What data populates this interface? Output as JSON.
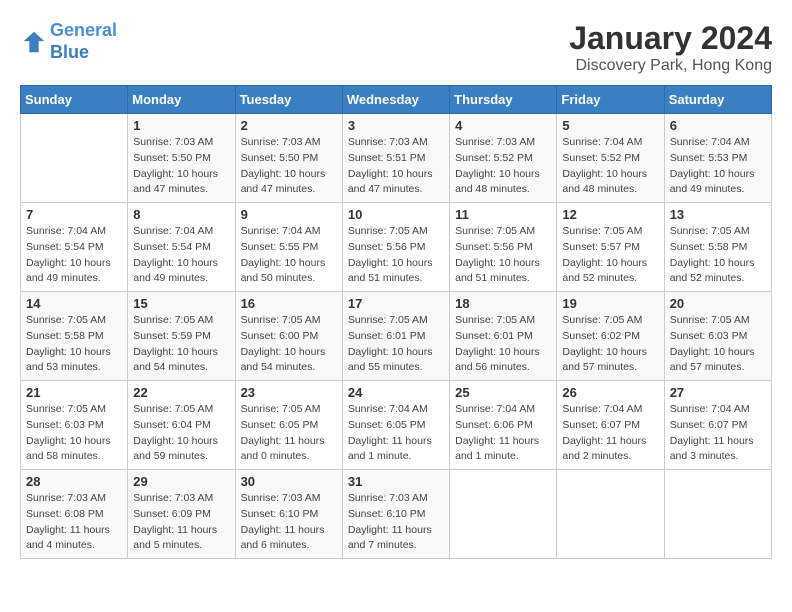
{
  "header": {
    "logo_line1": "General",
    "logo_line2": "Blue",
    "title": "January 2024",
    "subtitle": "Discovery Park, Hong Kong"
  },
  "days_of_week": [
    "Sunday",
    "Monday",
    "Tuesday",
    "Wednesday",
    "Thursday",
    "Friday",
    "Saturday"
  ],
  "weeks": [
    [
      {
        "day": "",
        "sunrise": "",
        "sunset": "",
        "daylight": ""
      },
      {
        "day": "1",
        "sunrise": "Sunrise: 7:03 AM",
        "sunset": "Sunset: 5:50 PM",
        "daylight": "Daylight: 10 hours and 47 minutes."
      },
      {
        "day": "2",
        "sunrise": "Sunrise: 7:03 AM",
        "sunset": "Sunset: 5:50 PM",
        "daylight": "Daylight: 10 hours and 47 minutes."
      },
      {
        "day": "3",
        "sunrise": "Sunrise: 7:03 AM",
        "sunset": "Sunset: 5:51 PM",
        "daylight": "Daylight: 10 hours and 47 minutes."
      },
      {
        "day": "4",
        "sunrise": "Sunrise: 7:03 AM",
        "sunset": "Sunset: 5:52 PM",
        "daylight": "Daylight: 10 hours and 48 minutes."
      },
      {
        "day": "5",
        "sunrise": "Sunrise: 7:04 AM",
        "sunset": "Sunset: 5:52 PM",
        "daylight": "Daylight: 10 hours and 48 minutes."
      },
      {
        "day": "6",
        "sunrise": "Sunrise: 7:04 AM",
        "sunset": "Sunset: 5:53 PM",
        "daylight": "Daylight: 10 hours and 49 minutes."
      }
    ],
    [
      {
        "day": "7",
        "sunrise": "Sunrise: 7:04 AM",
        "sunset": "Sunset: 5:54 PM",
        "daylight": "Daylight: 10 hours and 49 minutes."
      },
      {
        "day": "8",
        "sunrise": "Sunrise: 7:04 AM",
        "sunset": "Sunset: 5:54 PM",
        "daylight": "Daylight: 10 hours and 49 minutes."
      },
      {
        "day": "9",
        "sunrise": "Sunrise: 7:04 AM",
        "sunset": "Sunset: 5:55 PM",
        "daylight": "Daylight: 10 hours and 50 minutes."
      },
      {
        "day": "10",
        "sunrise": "Sunrise: 7:05 AM",
        "sunset": "Sunset: 5:56 PM",
        "daylight": "Daylight: 10 hours and 51 minutes."
      },
      {
        "day": "11",
        "sunrise": "Sunrise: 7:05 AM",
        "sunset": "Sunset: 5:56 PM",
        "daylight": "Daylight: 10 hours and 51 minutes."
      },
      {
        "day": "12",
        "sunrise": "Sunrise: 7:05 AM",
        "sunset": "Sunset: 5:57 PM",
        "daylight": "Daylight: 10 hours and 52 minutes."
      },
      {
        "day": "13",
        "sunrise": "Sunrise: 7:05 AM",
        "sunset": "Sunset: 5:58 PM",
        "daylight": "Daylight: 10 hours and 52 minutes."
      }
    ],
    [
      {
        "day": "14",
        "sunrise": "Sunrise: 7:05 AM",
        "sunset": "Sunset: 5:58 PM",
        "daylight": "Daylight: 10 hours and 53 minutes."
      },
      {
        "day": "15",
        "sunrise": "Sunrise: 7:05 AM",
        "sunset": "Sunset: 5:59 PM",
        "daylight": "Daylight: 10 hours and 54 minutes."
      },
      {
        "day": "16",
        "sunrise": "Sunrise: 7:05 AM",
        "sunset": "Sunset: 6:00 PM",
        "daylight": "Daylight: 10 hours and 54 minutes."
      },
      {
        "day": "17",
        "sunrise": "Sunrise: 7:05 AM",
        "sunset": "Sunset: 6:01 PM",
        "daylight": "Daylight: 10 hours and 55 minutes."
      },
      {
        "day": "18",
        "sunrise": "Sunrise: 7:05 AM",
        "sunset": "Sunset: 6:01 PM",
        "daylight": "Daylight: 10 hours and 56 minutes."
      },
      {
        "day": "19",
        "sunrise": "Sunrise: 7:05 AM",
        "sunset": "Sunset: 6:02 PM",
        "daylight": "Daylight: 10 hours and 57 minutes."
      },
      {
        "day": "20",
        "sunrise": "Sunrise: 7:05 AM",
        "sunset": "Sunset: 6:03 PM",
        "daylight": "Daylight: 10 hours and 57 minutes."
      }
    ],
    [
      {
        "day": "21",
        "sunrise": "Sunrise: 7:05 AM",
        "sunset": "Sunset: 6:03 PM",
        "daylight": "Daylight: 10 hours and 58 minutes."
      },
      {
        "day": "22",
        "sunrise": "Sunrise: 7:05 AM",
        "sunset": "Sunset: 6:04 PM",
        "daylight": "Daylight: 10 hours and 59 minutes."
      },
      {
        "day": "23",
        "sunrise": "Sunrise: 7:05 AM",
        "sunset": "Sunset: 6:05 PM",
        "daylight": "Daylight: 11 hours and 0 minutes."
      },
      {
        "day": "24",
        "sunrise": "Sunrise: 7:04 AM",
        "sunset": "Sunset: 6:05 PM",
        "daylight": "Daylight: 11 hours and 1 minute."
      },
      {
        "day": "25",
        "sunrise": "Sunrise: 7:04 AM",
        "sunset": "Sunset: 6:06 PM",
        "daylight": "Daylight: 11 hours and 1 minute."
      },
      {
        "day": "26",
        "sunrise": "Sunrise: 7:04 AM",
        "sunset": "Sunset: 6:07 PM",
        "daylight": "Daylight: 11 hours and 2 minutes."
      },
      {
        "day": "27",
        "sunrise": "Sunrise: 7:04 AM",
        "sunset": "Sunset: 6:07 PM",
        "daylight": "Daylight: 11 hours and 3 minutes."
      }
    ],
    [
      {
        "day": "28",
        "sunrise": "Sunrise: 7:03 AM",
        "sunset": "Sunset: 6:08 PM",
        "daylight": "Daylight: 11 hours and 4 minutes."
      },
      {
        "day": "29",
        "sunrise": "Sunrise: 7:03 AM",
        "sunset": "Sunset: 6:09 PM",
        "daylight": "Daylight: 11 hours and 5 minutes."
      },
      {
        "day": "30",
        "sunrise": "Sunrise: 7:03 AM",
        "sunset": "Sunset: 6:10 PM",
        "daylight": "Daylight: 11 hours and 6 minutes."
      },
      {
        "day": "31",
        "sunrise": "Sunrise: 7:03 AM",
        "sunset": "Sunset: 6:10 PM",
        "daylight": "Daylight: 11 hours and 7 minutes."
      },
      {
        "day": "",
        "sunrise": "",
        "sunset": "",
        "daylight": ""
      },
      {
        "day": "",
        "sunrise": "",
        "sunset": "",
        "daylight": ""
      },
      {
        "day": "",
        "sunrise": "",
        "sunset": "",
        "daylight": ""
      }
    ]
  ]
}
